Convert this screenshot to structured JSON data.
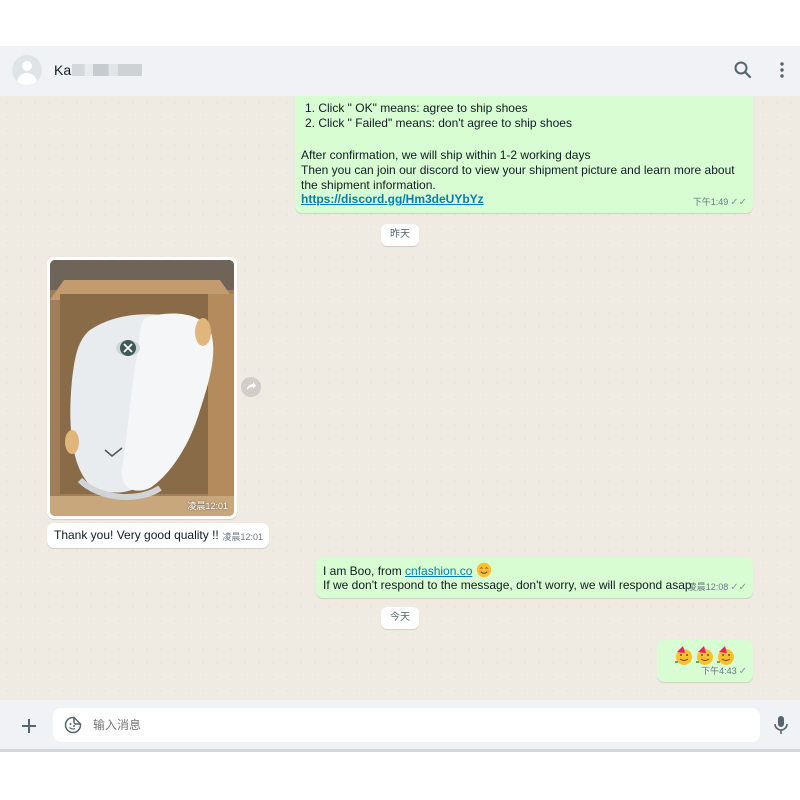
{
  "header": {
    "contact_name": "Ka",
    "search_icon": "search-icon",
    "menu_icon": "kebab-menu-icon"
  },
  "messages": {
    "confirm": {
      "item1": "1. Click \" OK\" means: agree to ship shoes",
      "item2": "2. Click \" Failed\" means: don't agree to ship shoes",
      "p1": "After confirmation, we will ship within 1-2 working days",
      "p2": "Then you can join our discord to view your shipment picture and learn more about",
      "p3": "the shipment information.",
      "link": "https://discord.gg/Hm3deUYbYz",
      "time": "下午1:49"
    },
    "day_yesterday": "昨天",
    "photo": {
      "time": "凌晨12:01"
    },
    "thanks": {
      "text": "Thank you! Very good quality !!",
      "time": "凌晨12:01"
    },
    "intro": {
      "prefix": "I am Boo, from ",
      "link": "cnfashion.co",
      "line2": "If we don't respond to the message, don't worry, we will respond asap",
      "time": "凌晨12:08"
    },
    "day_today": "今天",
    "emoji_msg": {
      "time": "下午4:43"
    }
  },
  "footer": {
    "placeholder": "输入消息",
    "plus_icon": "plus-icon",
    "sticker_icon": "sticker-icon",
    "mic_icon": "microphone-icon"
  },
  "colors": {
    "outgoing_bubble": "#d9fdd3",
    "incoming_bubble": "#ffffff",
    "chat_background": "#efeae2",
    "link": "#027eb5"
  }
}
